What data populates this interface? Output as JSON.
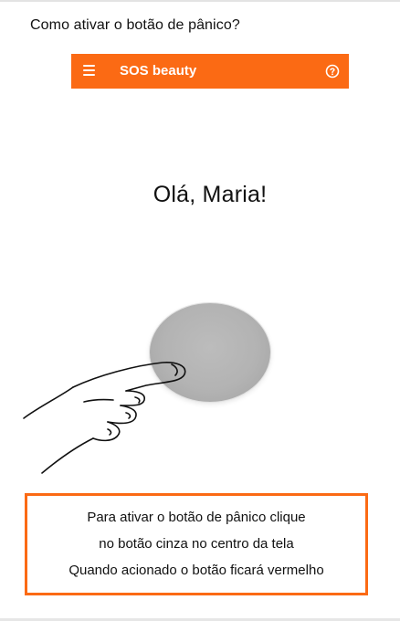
{
  "page": {
    "question": "Como ativar o botão de pânico?"
  },
  "app_bar": {
    "title": "SOS beauty",
    "background_color": "#fb6a14",
    "left_icon": "menu-icon",
    "right_icon": "help-icon"
  },
  "main": {
    "greeting": "Olá, Maria!"
  },
  "panic_button": {
    "color": "#b3b3b3"
  },
  "instructions": {
    "lines": [
      "Para ativar o botão de pânico clique",
      "no botão cinza no centro da tela",
      "Quando acionado o botão ficará vermelho"
    ],
    "border_color": "#fb6a14"
  }
}
